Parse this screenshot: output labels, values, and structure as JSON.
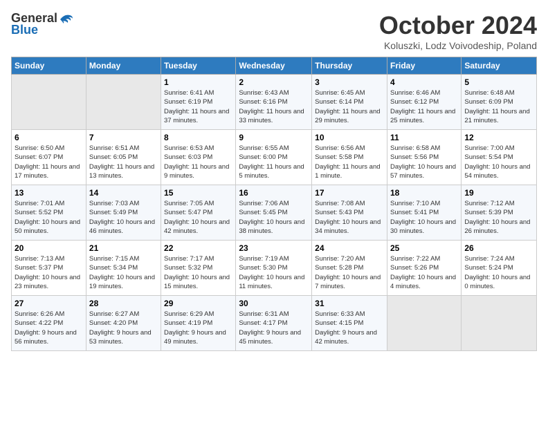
{
  "logo": {
    "general": "General",
    "blue": "Blue"
  },
  "title": "October 2024",
  "subtitle": "Koluszki, Lodz Voivodeship, Poland",
  "headers": [
    "Sunday",
    "Monday",
    "Tuesday",
    "Wednesday",
    "Thursday",
    "Friday",
    "Saturday"
  ],
  "weeks": [
    [
      {
        "day": "",
        "info": ""
      },
      {
        "day": "",
        "info": ""
      },
      {
        "day": "1",
        "info": "Sunrise: 6:41 AM\nSunset: 6:19 PM\nDaylight: 11 hours and 37 minutes."
      },
      {
        "day": "2",
        "info": "Sunrise: 6:43 AM\nSunset: 6:16 PM\nDaylight: 11 hours and 33 minutes."
      },
      {
        "day": "3",
        "info": "Sunrise: 6:45 AM\nSunset: 6:14 PM\nDaylight: 11 hours and 29 minutes."
      },
      {
        "day": "4",
        "info": "Sunrise: 6:46 AM\nSunset: 6:12 PM\nDaylight: 11 hours and 25 minutes."
      },
      {
        "day": "5",
        "info": "Sunrise: 6:48 AM\nSunset: 6:09 PM\nDaylight: 11 hours and 21 minutes."
      }
    ],
    [
      {
        "day": "6",
        "info": "Sunrise: 6:50 AM\nSunset: 6:07 PM\nDaylight: 11 hours and 17 minutes."
      },
      {
        "day": "7",
        "info": "Sunrise: 6:51 AM\nSunset: 6:05 PM\nDaylight: 11 hours and 13 minutes."
      },
      {
        "day": "8",
        "info": "Sunrise: 6:53 AM\nSunset: 6:03 PM\nDaylight: 11 hours and 9 minutes."
      },
      {
        "day": "9",
        "info": "Sunrise: 6:55 AM\nSunset: 6:00 PM\nDaylight: 11 hours and 5 minutes."
      },
      {
        "day": "10",
        "info": "Sunrise: 6:56 AM\nSunset: 5:58 PM\nDaylight: 11 hours and 1 minute."
      },
      {
        "day": "11",
        "info": "Sunrise: 6:58 AM\nSunset: 5:56 PM\nDaylight: 10 hours and 57 minutes."
      },
      {
        "day": "12",
        "info": "Sunrise: 7:00 AM\nSunset: 5:54 PM\nDaylight: 10 hours and 54 minutes."
      }
    ],
    [
      {
        "day": "13",
        "info": "Sunrise: 7:01 AM\nSunset: 5:52 PM\nDaylight: 10 hours and 50 minutes."
      },
      {
        "day": "14",
        "info": "Sunrise: 7:03 AM\nSunset: 5:49 PM\nDaylight: 10 hours and 46 minutes."
      },
      {
        "day": "15",
        "info": "Sunrise: 7:05 AM\nSunset: 5:47 PM\nDaylight: 10 hours and 42 minutes."
      },
      {
        "day": "16",
        "info": "Sunrise: 7:06 AM\nSunset: 5:45 PM\nDaylight: 10 hours and 38 minutes."
      },
      {
        "day": "17",
        "info": "Sunrise: 7:08 AM\nSunset: 5:43 PM\nDaylight: 10 hours and 34 minutes."
      },
      {
        "day": "18",
        "info": "Sunrise: 7:10 AM\nSunset: 5:41 PM\nDaylight: 10 hours and 30 minutes."
      },
      {
        "day": "19",
        "info": "Sunrise: 7:12 AM\nSunset: 5:39 PM\nDaylight: 10 hours and 26 minutes."
      }
    ],
    [
      {
        "day": "20",
        "info": "Sunrise: 7:13 AM\nSunset: 5:37 PM\nDaylight: 10 hours and 23 minutes."
      },
      {
        "day": "21",
        "info": "Sunrise: 7:15 AM\nSunset: 5:34 PM\nDaylight: 10 hours and 19 minutes."
      },
      {
        "day": "22",
        "info": "Sunrise: 7:17 AM\nSunset: 5:32 PM\nDaylight: 10 hours and 15 minutes."
      },
      {
        "day": "23",
        "info": "Sunrise: 7:19 AM\nSunset: 5:30 PM\nDaylight: 10 hours and 11 minutes."
      },
      {
        "day": "24",
        "info": "Sunrise: 7:20 AM\nSunset: 5:28 PM\nDaylight: 10 hours and 7 minutes."
      },
      {
        "day": "25",
        "info": "Sunrise: 7:22 AM\nSunset: 5:26 PM\nDaylight: 10 hours and 4 minutes."
      },
      {
        "day": "26",
        "info": "Sunrise: 7:24 AM\nSunset: 5:24 PM\nDaylight: 10 hours and 0 minutes."
      }
    ],
    [
      {
        "day": "27",
        "info": "Sunrise: 6:26 AM\nSunset: 4:22 PM\nDaylight: 9 hours and 56 minutes."
      },
      {
        "day": "28",
        "info": "Sunrise: 6:27 AM\nSunset: 4:20 PM\nDaylight: 9 hours and 53 minutes."
      },
      {
        "day": "29",
        "info": "Sunrise: 6:29 AM\nSunset: 4:19 PM\nDaylight: 9 hours and 49 minutes."
      },
      {
        "day": "30",
        "info": "Sunrise: 6:31 AM\nSunset: 4:17 PM\nDaylight: 9 hours and 45 minutes."
      },
      {
        "day": "31",
        "info": "Sunrise: 6:33 AM\nSunset: 4:15 PM\nDaylight: 9 hours and 42 minutes."
      },
      {
        "day": "",
        "info": ""
      },
      {
        "day": "",
        "info": ""
      }
    ]
  ]
}
